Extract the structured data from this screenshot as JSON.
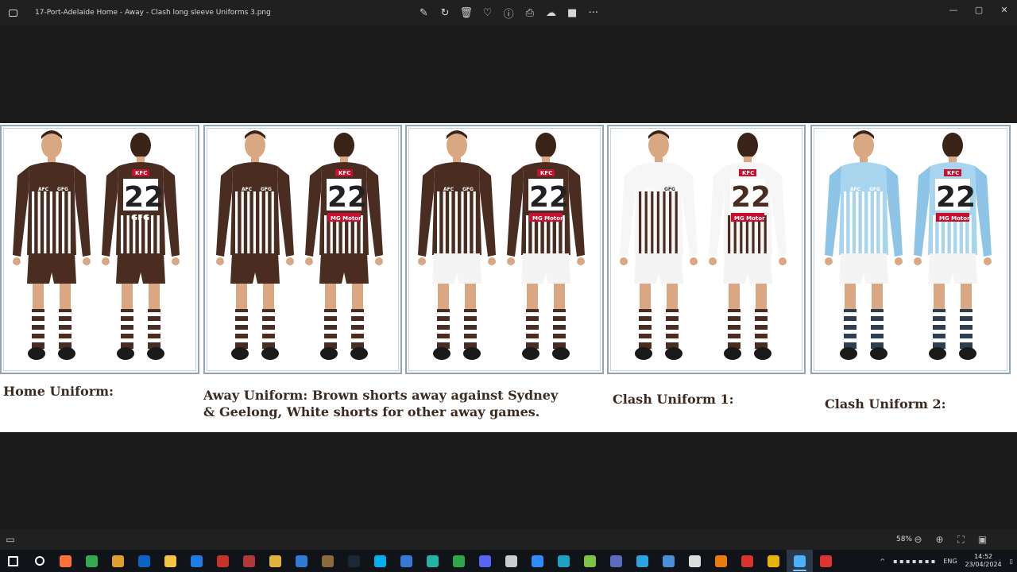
{
  "window": {
    "title": "17-Port-Adelaide Home - Away - Clash long sleeve Uniforms 3.png",
    "icon": "photos-app-icon"
  },
  "toolbar": {
    "buttons": [
      {
        "name": "edit-image-icon",
        "glyph": "✎"
      },
      {
        "name": "rotate-icon",
        "glyph": "↻"
      },
      {
        "name": "delete-icon",
        "glyph": "🗑"
      },
      {
        "name": "favorite-icon",
        "glyph": "♡"
      },
      {
        "name": "info-icon",
        "glyph": "ⓘ"
      },
      {
        "name": "print-icon",
        "glyph": "⎙"
      },
      {
        "name": "onedrive-icon",
        "glyph": "☁"
      },
      {
        "name": "clipchamp-icon",
        "glyph": "■"
      },
      {
        "name": "more-options-icon",
        "glyph": "···"
      }
    ]
  },
  "window_controls": {
    "minimize": "—",
    "maximize": "▢",
    "close": "✕"
  },
  "image": {
    "captions": [
      "Home Uniform:",
      "Away Uniform: Brown shorts away against Sydney & Geelong, White shorts for other away games.",
      "Clash Uniform 1:",
      "Clash Uniform 2:"
    ],
    "panels": [
      {
        "jersey": "#4a2c20",
        "stripe": "#ffffff",
        "shorts": "#4a2c20",
        "sleeve": "#4a2c20",
        "front_sponsor": "GFG",
        "back_sponsor": "GFG",
        "number": "22"
      },
      {
        "jersey": "#4a2c20",
        "stripe": "#ffffff",
        "shorts": "#4a2c20",
        "sleeve": "#4a2c20",
        "front_sponsor": "GFG",
        "back_sponsor": "MG Motor",
        "number": "22"
      },
      {
        "jersey": "#4a2c20",
        "stripe": "#ffffff",
        "shorts": "#f4f4f4",
        "sleeve": "#4a2c20",
        "front_sponsor": "GFG",
        "back_sponsor": "MG Motor",
        "number": "22"
      },
      {
        "jersey": "#f6f6f6",
        "stripe": "#4a2c20",
        "shorts": "#f4f4f4",
        "sleeve": "#f6f6f6",
        "front_sponsor": "GFG",
        "back_sponsor": "MG Motor",
        "number": "22"
      },
      {
        "jersey": "#a9d4ee",
        "stripe": "#ffffff",
        "shorts": "#f4f4f4",
        "sleeve": "#8ec4e8",
        "front_sponsor": "GFG",
        "back_sponsor": "MG Motor",
        "number": "22"
      }
    ],
    "back_top_sponsor": "KFC",
    "afc_logo": "AFC"
  },
  "statusbar": {
    "zoom": "58%",
    "icons": [
      "filmstrip-icon",
      "zoom-out-icon",
      "zoom-in-icon",
      "fit-to-window-icon",
      "fullscreen-icon"
    ]
  },
  "taskbar": {
    "apps": [
      {
        "name": "start-icon",
        "color": "#ffffff"
      },
      {
        "name": "search-icon",
        "color": "#ffffff"
      },
      {
        "name": "firefox-icon",
        "color": "#ff7139"
      },
      {
        "name": "chrome-icon",
        "color": "#34a853"
      },
      {
        "name": "media-player-icon",
        "color": "#e0a030"
      },
      {
        "name": "outlook-icon",
        "color": "#0a64c8"
      },
      {
        "name": "file-explorer-icon",
        "color": "#f5c542"
      },
      {
        "name": "teamviewer-icon",
        "color": "#1d7ce6"
      },
      {
        "name": "app-red-icon",
        "color": "#c8322a"
      },
      {
        "name": "app-game-icon",
        "color": "#b03838"
      },
      {
        "name": "app-yellow-icon",
        "color": "#e2b33a"
      },
      {
        "name": "app-blue-circle-icon",
        "color": "#2f7ad6"
      },
      {
        "name": "app-brown-icon",
        "color": "#8a6a3a"
      },
      {
        "name": "steam-icon",
        "color": "#1b2838"
      },
      {
        "name": "skype-icon",
        "color": "#00aff0"
      },
      {
        "name": "app-gear-icon",
        "color": "#3a78d8"
      },
      {
        "name": "edge-icon",
        "color": "#23b2a5"
      },
      {
        "name": "audition-icon",
        "color": "#2fa64a"
      },
      {
        "name": "discord-icon",
        "color": "#5865f2"
      },
      {
        "name": "app-feather-icon",
        "color": "#cccccc"
      },
      {
        "name": "zoom-icon",
        "color": "#2d8cff"
      },
      {
        "name": "app-teal-icon",
        "color": "#1ca3c4"
      },
      {
        "name": "app-green-icon",
        "color": "#7cc442"
      },
      {
        "name": "app-lock-icon",
        "color": "#5c6bc0"
      },
      {
        "name": "telegram-icon",
        "color": "#2aa3df"
      },
      {
        "name": "app-globe-icon",
        "color": "#4a90d9"
      },
      {
        "name": "clapper-icon",
        "color": "#dddddd"
      },
      {
        "name": "blender-icon",
        "color": "#e87d0d"
      },
      {
        "name": "app-red-box-icon",
        "color": "#d9342b"
      },
      {
        "name": "app-m-icon",
        "color": "#e6b400"
      },
      {
        "name": "photos-icon",
        "color": "#4ab0ff"
      },
      {
        "name": "app-dark-circle-icon",
        "color": "#d33"
      }
    ]
  },
  "tray": {
    "language": "ENG",
    "time": "14:52",
    "date": "23/04/2024"
  }
}
